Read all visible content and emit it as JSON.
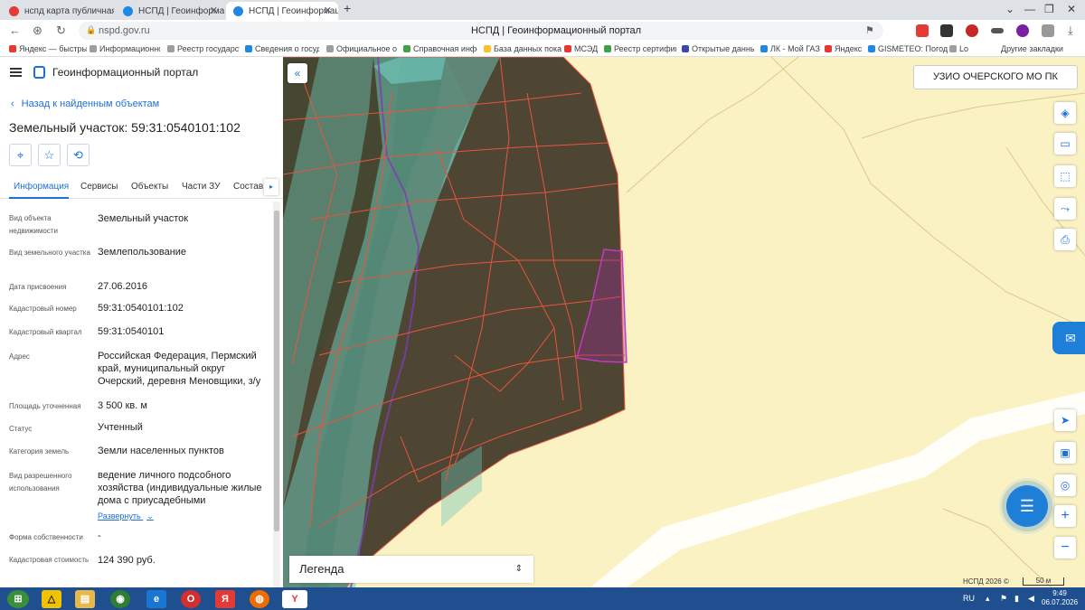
{
  "browser": {
    "tabs": [
      {
        "title": "нспд карта публичная кадастровая",
        "active": false
      },
      {
        "title": "НСПД | Геоинформационный",
        "active": false
      },
      {
        "title": "НСПД | Геоинформационный",
        "active": true
      }
    ],
    "new_tab": "+",
    "window_controls": [
      "⌄",
      "—",
      "❐",
      "✕"
    ],
    "url": "nspd.gov.ru",
    "page_title": "НСПД | Геоинформационный портал",
    "bookmarks": [
      "Яндекс — быстрый",
      "Информационно",
      "Реестр государст",
      "Сведения о госуд",
      "Официальное оп",
      "Справочная инфо",
      "База данных пока",
      "МСЭД",
      "Реестр сертифик",
      "Открытые данны",
      "ЛК - Мой ГАЗ",
      "Яндекс",
      "GISMETEO: Погода",
      "Lo"
    ],
    "other_bookmarks": "Другие закладки"
  },
  "panel": {
    "portal_name": "Геоинформационный портал",
    "back_link": "Назад к найденным объектам",
    "object_title": "Земельный участок: 59:31:0540101:102",
    "tabs": [
      "Информация",
      "Сервисы",
      "Объекты",
      "Части ЗУ",
      "Состав"
    ],
    "tab_next": "▸",
    "fields": [
      {
        "label": "Вид объекта недвижимости",
        "value": "Земельный участок"
      },
      {
        "label": "Вид земельного участка",
        "value": "Землепользование"
      },
      {
        "label": "Дата присвоения",
        "value": "27.06.2016"
      },
      {
        "label": "Кадастровый номер",
        "value": "59:31:0540101:102"
      },
      {
        "label": "Кадастровый квартал",
        "value": "59:31:0540101"
      },
      {
        "label": "Адрес",
        "value": "Российская Федерация, Пермский край, муниципальный округ Очерский, деревня Меновщики, з/у"
      },
      {
        "label": "Площадь уточненная",
        "value": "3 500 кв. м"
      },
      {
        "label": "Статус",
        "value": "Учтенный"
      },
      {
        "label": "Категория земель",
        "value": "Земли населенных пунктов"
      },
      {
        "label": "Вид разрешенного использования",
        "value": "ведение личного подсобного хозяйства (индивидуальные жилые дома с приусадебными земельными"
      },
      {
        "label": "Форма собственности",
        "value": "-"
      },
      {
        "label": "Кадастровая стоимость",
        "value": "124 390 руб."
      }
    ],
    "expand_link": "Развернуть"
  },
  "map": {
    "region_button": "УЗИО ОЧЕРСКОГО МО ПК",
    "legend_label": "Легенда",
    "copyright": "НСПД 2026 ©",
    "scale": "50 м",
    "colors": {
      "zone": "#fbf2c4",
      "parcel_line": "#e8553e",
      "selected": "#a0289a",
      "water": "#6ec5b8"
    }
  },
  "taskbar": {
    "lang": "RU",
    "time": "9:49",
    "date": "06.07.2026"
  }
}
